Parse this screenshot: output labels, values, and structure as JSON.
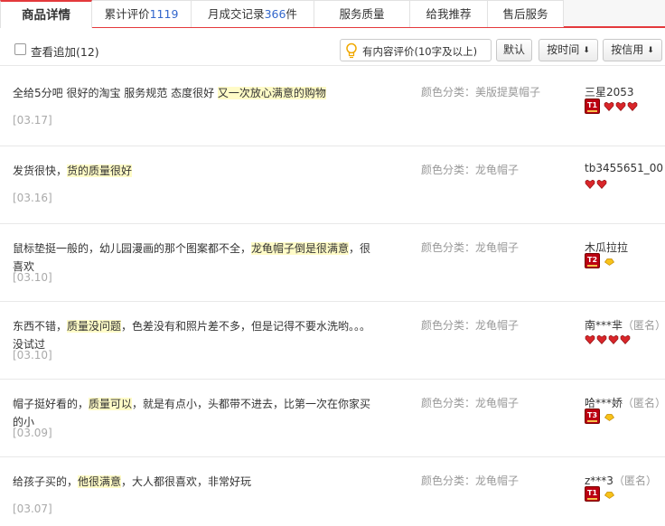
{
  "tabs": [
    {
      "label": "商品详情",
      "count": ""
    },
    {
      "label": "累计评价",
      "count": "1119"
    },
    {
      "label": "月成交记录",
      "count": "366",
      "suffix": "件"
    },
    {
      "label": "服务质量",
      "count": ""
    },
    {
      "label": "给我推荐",
      "count": ""
    },
    {
      "label": "售后服务",
      "count": ""
    }
  ],
  "filters": {
    "append_checkbox_label": "查看追加(12)",
    "content_review_label": "有内容评价(10字及以上)",
    "default_label": "默认",
    "by_time_label": "按时间",
    "by_credit_label": "按信用",
    "arrow": "⬇"
  },
  "sku_prefix": "颜色分类：",
  "anon_label": "（匿名）",
  "reviews": [
    {
      "text_plain": "全给5分吧 很好的淘宝 服务规范 态度很好 ",
      "text_highlight": "又一次放心满意的购物",
      "text_after": "",
      "date": "[03.17]",
      "sku": "美版提莫帽子",
      "user": "三星2053",
      "anonymous": false,
      "badge": "T1",
      "level_icons": "hearts",
      "level_count": 3
    },
    {
      "text_plain": "发货很快，",
      "text_highlight": "货的质量很好",
      "text_after": "",
      "date": "[03.16]",
      "sku": "龙龟帽子",
      "user": "tb3455651_00",
      "anonymous": false,
      "badge": "",
      "level_icons": "hearts",
      "level_count": 2
    },
    {
      "text_plain": "鼠标垫挺一般的，幼儿园漫画的那个图案都不全，",
      "text_highlight": "龙龟帽子倒是很满意",
      "text_after": "，很喜欢",
      "date": "[03.10]",
      "sku": "龙龟帽子",
      "user": "木瓜拉拉",
      "anonymous": false,
      "badge": "T2",
      "level_icons": "crown",
      "level_count": 1
    },
    {
      "text_plain": "东西不错，",
      "text_highlight": "质量没问题",
      "text_after": "，色差没有和照片差不多，但是记得不要水洗哟。。。没试过",
      "date": "[03.10]",
      "sku": "龙龟帽子",
      "user": "南***芈",
      "anonymous": true,
      "badge": "",
      "level_icons": "hearts",
      "level_count": 4
    },
    {
      "text_plain": "帽子挺好看的，",
      "text_highlight": "质量可以",
      "text_after": "，就是有点小，头都带不进去，比第一次在你家买的小",
      "date": "[03.09]",
      "sku": "龙龟帽子",
      "user": "哈***娇",
      "anonymous": true,
      "badge": "T3",
      "level_icons": "crown",
      "level_count": 1
    },
    {
      "text_plain": "给孩子买的，",
      "text_highlight": "他很满意",
      "text_after": "，大人都很喜欢，非常好玩",
      "date": "[03.07]",
      "sku": "龙龟帽子",
      "user": "z***3",
      "anonymous": true,
      "badge": "T1",
      "level_icons": "crown",
      "level_count": 1
    }
  ],
  "colors": {
    "accent": "#e4393c",
    "link": "#3266cc",
    "highlight_bg": "#fffbc7",
    "heart": "#d9262a",
    "crown": "#f0b400"
  }
}
